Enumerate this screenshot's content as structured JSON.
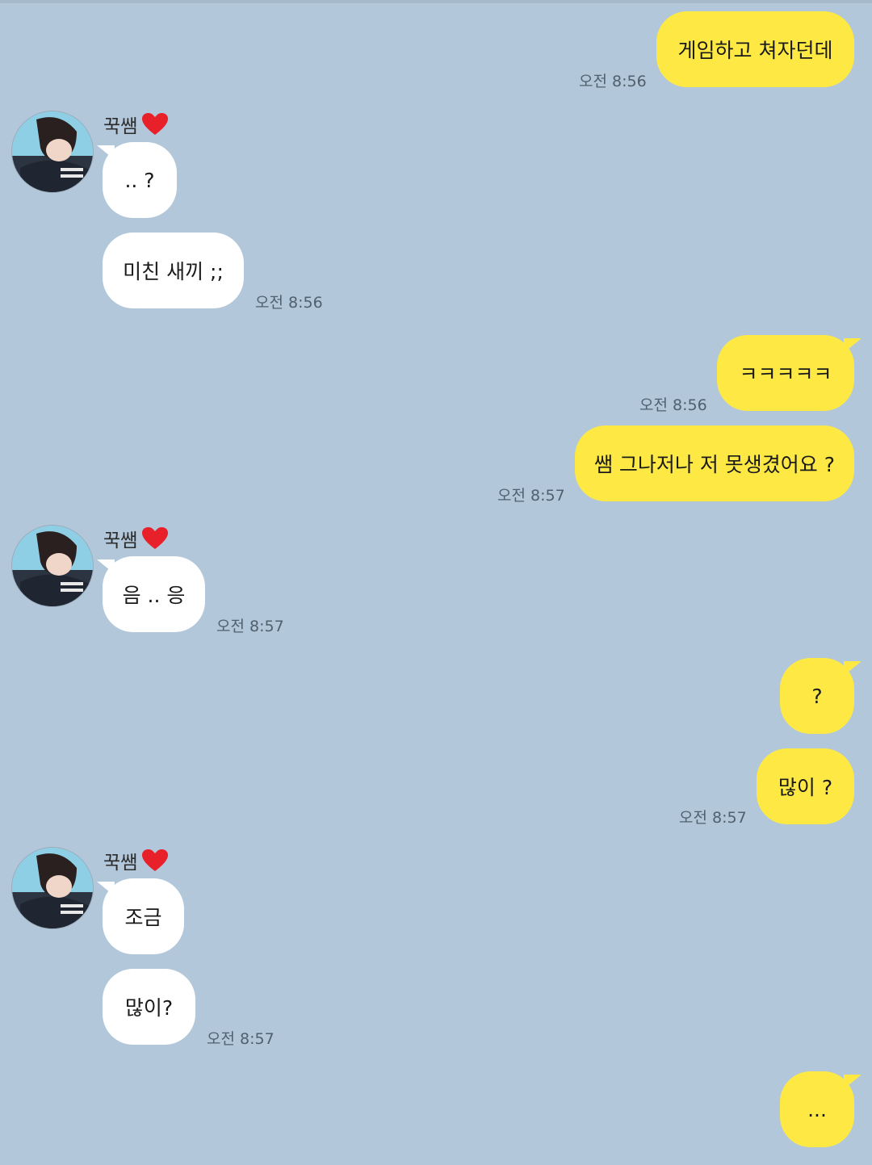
{
  "friend": {
    "name": "꾹쌤",
    "name_icon": "heart-icon"
  },
  "messages": [
    {
      "from": "me",
      "text": "게임하고 쳐자던데",
      "time": "오전 8:56"
    },
    {
      "from": "friend",
      "text": ".. ?"
    },
    {
      "from": "friend",
      "text": "미친 새끼 ;;",
      "time": "오전 8:56"
    },
    {
      "from": "me",
      "text": "ㅋㅋㅋㅋㅋ",
      "time": "오전 8:56"
    },
    {
      "from": "me",
      "text": "쌤 그나저나 저 못생겼어요 ?",
      "time": "오전 8:57"
    },
    {
      "from": "friend",
      "text": "음 .. 응",
      "time": "오전 8:57"
    },
    {
      "from": "me",
      "text": "?"
    },
    {
      "from": "me",
      "text": "많이 ?",
      "time": "오전 8:57"
    },
    {
      "from": "friend",
      "text": "조금"
    },
    {
      "from": "friend",
      "text": "많이?",
      "time": "오전 8:57"
    },
    {
      "from": "me",
      "text": "..."
    }
  ],
  "colors": {
    "background": "#b2c7d9",
    "my_bubble": "#fee944",
    "friend_bubble": "#ffffff",
    "heart": "#e8202a"
  }
}
